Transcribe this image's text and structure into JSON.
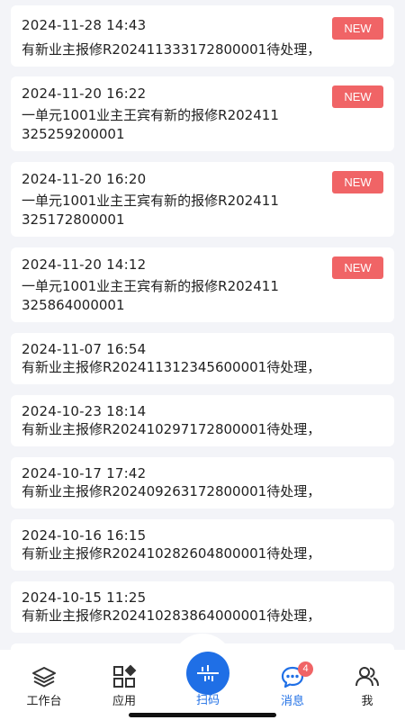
{
  "messages": [
    {
      "time": "2024-11-28 14:43",
      "text": "有新业主报修R202411333172800001待处理，",
      "badge": "NEW"
    },
    {
      "time": "2024-11-20 16:22",
      "text": "一单元1001业主王宾有新的报修R202411325259200001",
      "badge": "NEW"
    },
    {
      "time": "2024-11-20 16:20",
      "text": "一单元1001业主王宾有新的报修R202411325172800001",
      "badge": "NEW"
    },
    {
      "time": "2024-11-20 14:12",
      "text": "一单元1001业主王宾有新的报修R202411325864000001",
      "badge": "NEW"
    },
    {
      "time": "2024-11-07 16:54",
      "text": "有新业主报修R202411312345600001待处理，"
    },
    {
      "time": "2024-10-23 18:14",
      "text": "有新业主报修R202410297172800001待处理，"
    },
    {
      "time": "2024-10-17 17:42",
      "text": "有新业主报修R202409263172800001待处理，"
    },
    {
      "time": "2024-10-16 16:15",
      "text": "有新业主报修R202410282604800001待处理，"
    },
    {
      "time": "2024-10-15 11:25",
      "text": "有新业主报修R202410283864000001待处理，"
    }
  ],
  "tabbar": {
    "workbench": {
      "label": "工作台",
      "icon": "layers-icon"
    },
    "apps": {
      "label": "应用",
      "icon": "apps-grid-icon"
    },
    "scan": {
      "label": "扫码",
      "icon": "scan-icon"
    },
    "messages": {
      "label": "消息",
      "icon": "chat-bubble-icon",
      "badge": "4"
    },
    "me": {
      "label": "我",
      "icon": "users-icon"
    }
  },
  "colors": {
    "accent": "#1f6fe6",
    "badge": "#f06466",
    "background": "#f3f4f8"
  }
}
